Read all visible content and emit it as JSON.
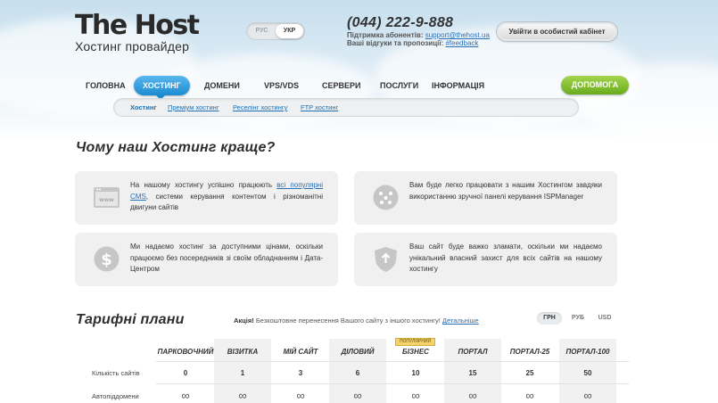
{
  "brand": {
    "name": "The Host",
    "subtitle": "Хостинг провайдер"
  },
  "lang": {
    "options": [
      "РУС",
      "УКР"
    ],
    "active": "УКР"
  },
  "contact": {
    "phone": "(044) 222-9-888",
    "support_label": "Підтримка абонентів:",
    "support_email": "support@thehost.ua",
    "feedback_label": "Ваші відгуки та пропозиції:",
    "feedback_link": "#feedback"
  },
  "cabinet_button": "Увійти в особистий кабінет",
  "nav": [
    "ГОЛОВНА",
    "ХОСТИНГ",
    "ДОМЕНИ",
    "VPS/VDS",
    "СЕРВЕРИ",
    "ПОСЛУГИ",
    "ІНФОРМАЦІЯ"
  ],
  "nav_active": "ХОСТИНГ",
  "help_button": "ДОПОМОГА",
  "subnav": [
    "Хостинг",
    "Преміум хостинг",
    "Реселінг хостингу",
    "FTP хостинг"
  ],
  "why": {
    "title": "Чому наш Хостинг краще?",
    "cards": [
      {
        "icon": "browser-icon",
        "text_before": "На нашому хостингу успішно працюють ",
        "link": "всі популярні CMS",
        "text_after": ", системи керування контентом і різноманітні двигуни сайтів"
      },
      {
        "icon": "control-panel-icon",
        "text_before": "Вам буде легко працювати з нашим Хостингом завдяки використанню зручної панелі керування ISPManager",
        "link": "",
        "text_after": ""
      },
      {
        "icon": "dollar-icon",
        "text_before": "Ми надаємо хостинг за доступними цінами, оскільки працюємо без посередників зі своїм обладнанням і Дата-Центром",
        "link": "",
        "text_after": ""
      },
      {
        "icon": "shield-icon",
        "text_before": "Ваш сайт буде важко зламати, оскільки ми надаємо унікальний власний захист для всіх сайтів на нашому хостингу",
        "link": "",
        "text_after": ""
      }
    ]
  },
  "tariffs": {
    "title": "Тарифні плани",
    "promo_label": "Акція!",
    "promo_text": "Безкоштовне перенесення Вашого сайту з іншого хостингу!",
    "promo_link": "Детальніше",
    "currencies": [
      "ГРН",
      "РУБ",
      "USD"
    ],
    "currency_active": "ГРН",
    "popular_badge": "ПОПУЛЯРНИЙ",
    "plans": [
      "ПАРКОВОЧНИЙ",
      "ВІЗИТКА",
      "МІЙ САЙТ",
      "ДІЛОВИЙ",
      "БІЗНЕС",
      "ПОРТАЛ",
      "ПОРТАЛ-25",
      "ПОРТАЛ-100"
    ],
    "rows": [
      {
        "label": "Кількість сайтів",
        "values": [
          "0",
          "1",
          "3",
          "6",
          "10",
          "15",
          "25",
          "50"
        ]
      },
      {
        "label": "Автопіддомени",
        "values": [
          "∞",
          "∞",
          "∞",
          "∞",
          "∞",
          "∞",
          "∞",
          "∞"
        ]
      }
    ]
  }
}
